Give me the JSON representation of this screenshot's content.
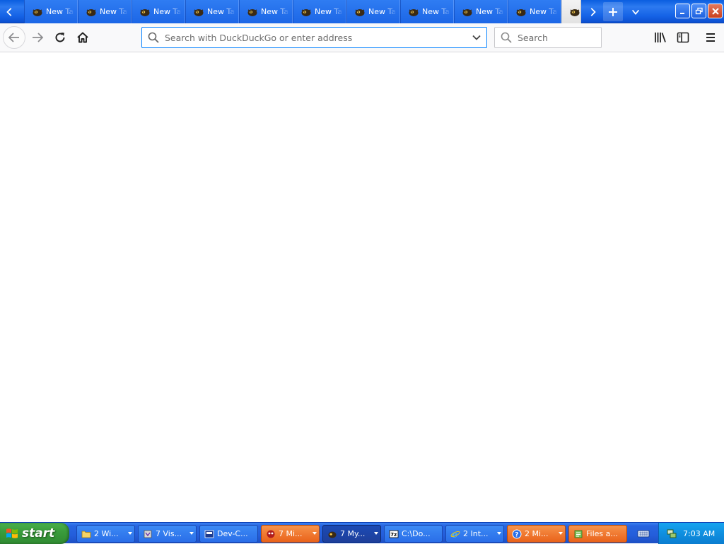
{
  "browser": {
    "tabs": [
      {
        "label": "New Tab",
        "selected": false
      },
      {
        "label": "New Tab",
        "selected": false
      },
      {
        "label": "New Tab",
        "selected": false
      },
      {
        "label": "New Tab",
        "selected": false
      },
      {
        "label": "New Tab",
        "selected": false
      },
      {
        "label": "New Tab",
        "selected": false
      },
      {
        "label": "New Tab",
        "selected": false
      },
      {
        "label": "New Tab",
        "selected": false
      },
      {
        "label": "New Tab",
        "selected": false
      },
      {
        "label": "New Tab",
        "selected": false
      },
      {
        "label": "",
        "selected": true
      }
    ],
    "urlbar": {
      "value": "",
      "placeholder": "Search with DuckDuckGo or enter address"
    },
    "searchbar": {
      "value": "",
      "placeholder": "Search"
    },
    "accent_color": "#0a84ff"
  },
  "taskbar": {
    "start_label": "start",
    "buttons": [
      {
        "label": "2 Wi...",
        "icon": "folder-icon",
        "style": "blue"
      },
      {
        "label": "7 Vis...",
        "icon": "visual-studio-icon",
        "style": "blue"
      },
      {
        "label": "Dev-C...",
        "icon": "dev-cpp-icon",
        "style": "blue"
      },
      {
        "label": "7 Mi...",
        "icon": "mozilla-icon",
        "style": "orange"
      },
      {
        "label": "7 My...",
        "icon": "firefox-icon",
        "style": "active"
      },
      {
        "label": "C:\\Do...",
        "icon": "7zip-icon",
        "style": "blue"
      },
      {
        "label": "2 Int...",
        "icon": "ie-icon",
        "style": "blue"
      },
      {
        "label": "2 Mi...",
        "icon": "help-icon",
        "style": "orange"
      },
      {
        "label": "Files a...",
        "icon": "files-icon",
        "style": "orange"
      }
    ],
    "clock": "7:03 AM"
  }
}
